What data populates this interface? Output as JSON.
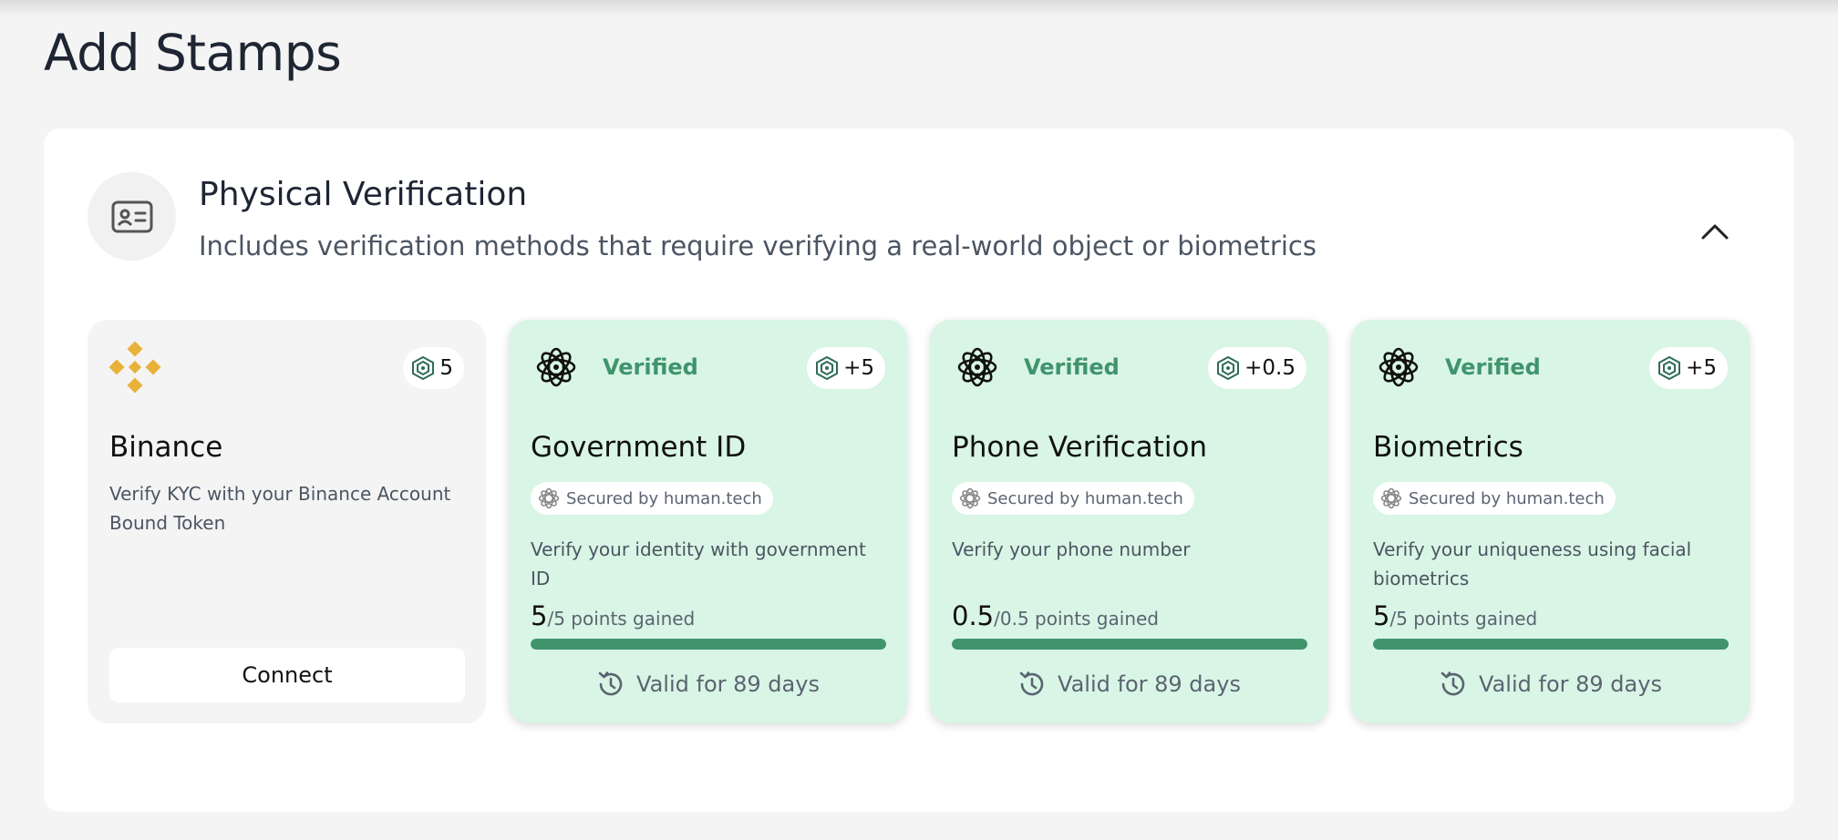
{
  "page": {
    "title": "Add Stamps"
  },
  "category": {
    "title": "Physical Verification",
    "description": "Includes verification methods that require verifying a real-world object or biometrics",
    "icon": "id-card-icon",
    "expanded": true
  },
  "colors": {
    "accent": "#3f946c",
    "verified_bg": "#d9f5e5",
    "binance_gold": "#f0b90b"
  },
  "cards": [
    {
      "name": "Binance",
      "icon": "binance-logo",
      "points_badge": "5",
      "description": "Verify KYC with your Binance Account Bound Token",
      "button_label": "Connect",
      "verified": false
    },
    {
      "name": "Government ID",
      "icon": "human-tech-logo",
      "verified_label": "Verified",
      "points_badge": "+5",
      "secured_label": "Secured by human.tech",
      "description": "Verify your identity with government ID",
      "points_gained": "5",
      "points_total": "/5 points gained",
      "progress": 1.0,
      "valid_label": "Valid for 89 days",
      "verified": true
    },
    {
      "name": "Phone Verification",
      "icon": "human-tech-logo",
      "verified_label": "Verified",
      "points_badge": "+0.5",
      "secured_label": "Secured by human.tech",
      "description": "Verify your phone number",
      "points_gained": "0.5",
      "points_total": "/0.5 points gained",
      "progress": 1.0,
      "valid_label": "Valid for 89 days",
      "verified": true
    },
    {
      "name": "Biometrics",
      "icon": "human-tech-logo",
      "verified_label": "Verified",
      "points_badge": "+5",
      "secured_label": "Secured by human.tech",
      "description": "Verify your uniqueness using facial biometrics",
      "points_gained": "5",
      "points_total": "/5 points gained",
      "progress": 1.0,
      "valid_label": "Valid for 89 days",
      "verified": true
    }
  ]
}
